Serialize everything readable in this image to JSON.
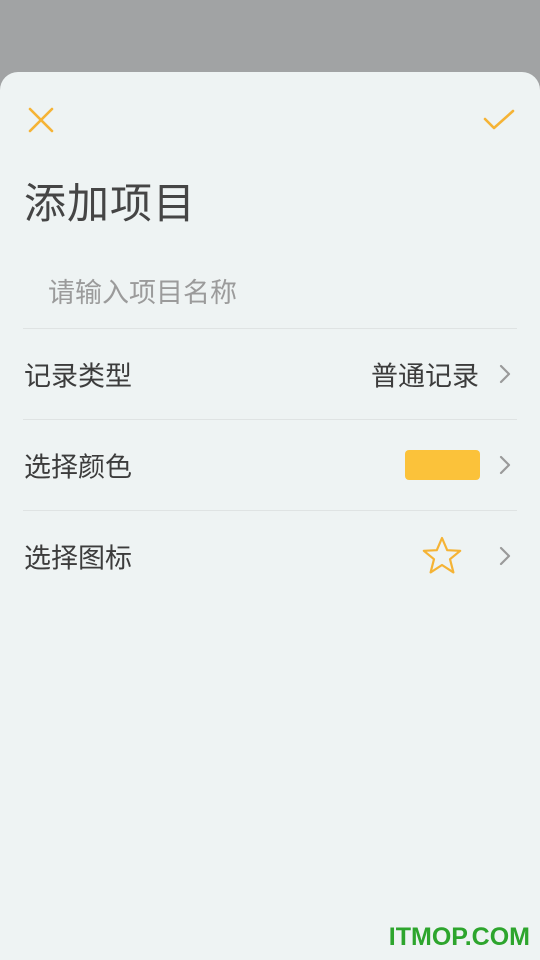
{
  "header": {
    "close_icon": "close-icon",
    "confirm_icon": "check-icon",
    "accent_color": "#f5b335"
  },
  "title": "添加项目",
  "name_input": {
    "placeholder": "请输入项目名称",
    "value": ""
  },
  "rows": [
    {
      "label": "记录类型",
      "value": "普通记录",
      "icon": "chevron-right-icon"
    },
    {
      "label": "选择颜色",
      "color": "#fbc23a",
      "icon": "chevron-right-icon"
    },
    {
      "label": "选择图标",
      "selected_icon": "star-icon",
      "icon": "chevron-right-icon"
    }
  ],
  "watermark": {
    "text": "ITMOP.COM",
    "color": "#2da52d"
  }
}
